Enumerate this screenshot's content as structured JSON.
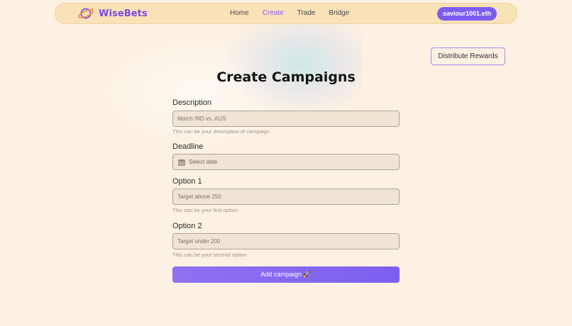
{
  "navbar": {
    "brand": "WiseBets",
    "links": [
      {
        "label": "Home",
        "active": false
      },
      {
        "label": "Create",
        "active": true
      },
      {
        "label": "Trade",
        "active": false
      },
      {
        "label": "Bridge",
        "active": false
      }
    ],
    "wallet_label": "saviour1001.eth"
  },
  "actions": {
    "distribute_label": "Distribute Rewards"
  },
  "page": {
    "title": "Create Campaigns"
  },
  "form": {
    "description": {
      "label": "Description",
      "placeholder": "Match IND vs. AUS",
      "helper": "This can be your description of campaign"
    },
    "deadline": {
      "label": "Deadline",
      "placeholder": "Select date"
    },
    "option1": {
      "label": "Option 1",
      "placeholder": "Target above 250",
      "helper": "This can be your first option"
    },
    "option2": {
      "label": "Option 2",
      "placeholder": "Target under 200",
      "helper": "This can be your second option"
    },
    "submit_label": "Add campaign 🚀"
  },
  "colors": {
    "background": "#fcf1e2",
    "navbar": "#f9e1b8",
    "accent": "#7c5df0",
    "field_bg": "#f0e5d4"
  },
  "icons": {
    "logo": "planet-icon",
    "calendar": "calendar-icon"
  }
}
